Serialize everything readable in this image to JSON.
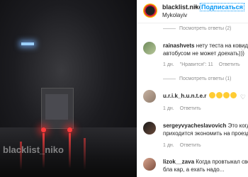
{
  "media": {
    "watermark": "blacklist_niko"
  },
  "header": {
    "username": "blacklist.niko",
    "separator": "•",
    "follow_label": "Подписаться",
    "location": "Mykolayiv"
  },
  "comments": [
    {
      "view_replies": "Посмотреть ответы (2)"
    },
    {
      "username": "rainashvets",
      "text_line1": "нету теста на ковид))",
      "text_line2": "автобусом не может доехать)))",
      "time": "1 дн.",
      "likes": "\"Нравится\": 11",
      "reply": "Ответить",
      "view_replies": "Посмотреть ответы (1)"
    },
    {
      "username": "u.r.i.k_h.u.n.t.e.r",
      "time": "1 дн.",
      "reply": "Ответить"
    },
    {
      "username": "sergeyvyacheslavovich",
      "text_line1": "Это когда",
      "text_line2": "приходится экономить на проезд",
      "time": "1 дн.",
      "reply": "Ответить"
    },
    {
      "username": "lizok__zava",
      "text_line1": "Когда провтыкал свой",
      "text_line2": "бла кар, а ехать надо..."
    }
  ]
}
